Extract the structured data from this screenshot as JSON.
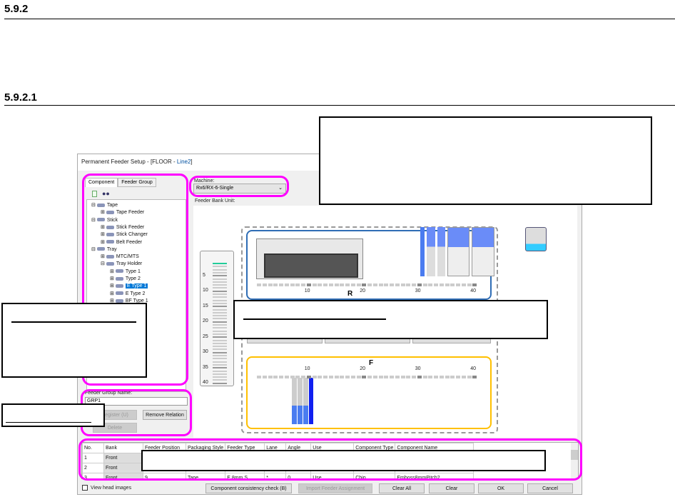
{
  "headings": {
    "h1": "5.9.2",
    "h2": "5.9.2.1"
  },
  "window": {
    "title_prefix": "Permanent Feeder Setup - [FLOOR - ",
    "title_line": "Line2",
    "title_suffix": "]"
  },
  "tabs": [
    {
      "label": "Component",
      "active": true
    },
    {
      "label": "Feeder Group",
      "active": false
    }
  ],
  "toolbar": {
    "icons": [
      "new-document-icon",
      "binoculars-icon"
    ]
  },
  "tree": [
    {
      "label": "Tape",
      "level": 0,
      "expander": "minus"
    },
    {
      "label": "Tape Feeder",
      "level": 1,
      "expander": "plus"
    },
    {
      "label": "Stick",
      "level": 0,
      "expander": "minus"
    },
    {
      "label": "Stick Feeder",
      "level": 1,
      "expander": "plus"
    },
    {
      "label": "Stick Changer",
      "level": 1,
      "expander": "plus"
    },
    {
      "label": "Belt Feeder",
      "level": 1,
      "expander": "plus"
    },
    {
      "label": "Tray",
      "level": 0,
      "expander": "minus"
    },
    {
      "label": "MTC/MTS",
      "level": 1,
      "expander": "plus"
    },
    {
      "label": "Tray Holder",
      "level": 1,
      "expander": "minus"
    },
    {
      "label": "Type 1",
      "level": 2,
      "expander": "plus"
    },
    {
      "label": "Type 2",
      "level": 2,
      "expander": "plus"
    },
    {
      "label": "E Type 1",
      "level": 2,
      "expander": "plus",
      "selected": true
    },
    {
      "label": "E Type 2",
      "level": 2,
      "expander": "plus"
    },
    {
      "label": "BF Type 1",
      "level": 2,
      "expander": "plus"
    },
    {
      "label": "2",
      "level": 2,
      "expander": "plus"
    }
  ],
  "machine": {
    "label": "Machine:",
    "value": "Rx6/RX-6-Single",
    "bank_label": "Feeder Bank Unit:"
  },
  "ruler": {
    "ticks": [
      "5",
      "10",
      "15",
      "20",
      "25",
      "30",
      "35",
      "40"
    ]
  },
  "banks": {
    "rear": {
      "label": "R",
      "ticks": [
        "10",
        "20",
        "30",
        "40"
      ],
      "color": "#2f6db5"
    },
    "front": {
      "label": "F",
      "ticks": [
        "10",
        "20",
        "30",
        "40"
      ],
      "color": "#ffc000"
    }
  },
  "feeder_group": {
    "label": "Feeder Group Name:",
    "value": "GRP1",
    "register": "Register (U)",
    "remove": "Remove Relation",
    "delete": "Delete"
  },
  "table": {
    "columns": [
      "No.",
      "Bank",
      "Feeder Position",
      "Packaging Style",
      "Feeder Type",
      "Lane",
      "Angle",
      "Use",
      "Component Type",
      "Component Name"
    ],
    "rows": [
      [
        "1",
        "Front",
        "",
        "",
        "",
        "",
        "",
        "",
        "",
        ""
      ],
      [
        "2",
        "Front",
        "",
        "",
        "",
        "",
        "",
        "",
        "",
        ""
      ],
      [
        "3",
        "Front",
        "9",
        "Tape",
        "E 8mm S",
        "*",
        "0",
        "Use",
        "Chip",
        "Emboss8mmPitch2"
      ]
    ]
  },
  "footer": {
    "view_head": "View head images",
    "consistency": "Component consistency check (B)",
    "import": "Import Feeder Assignment",
    "clear_all": "Clear All",
    "clear": "Clear",
    "ok": "OK",
    "cancel": "Cancel"
  },
  "colors": {
    "highlight": "#ff00ff",
    "selection": "#0078d7"
  }
}
